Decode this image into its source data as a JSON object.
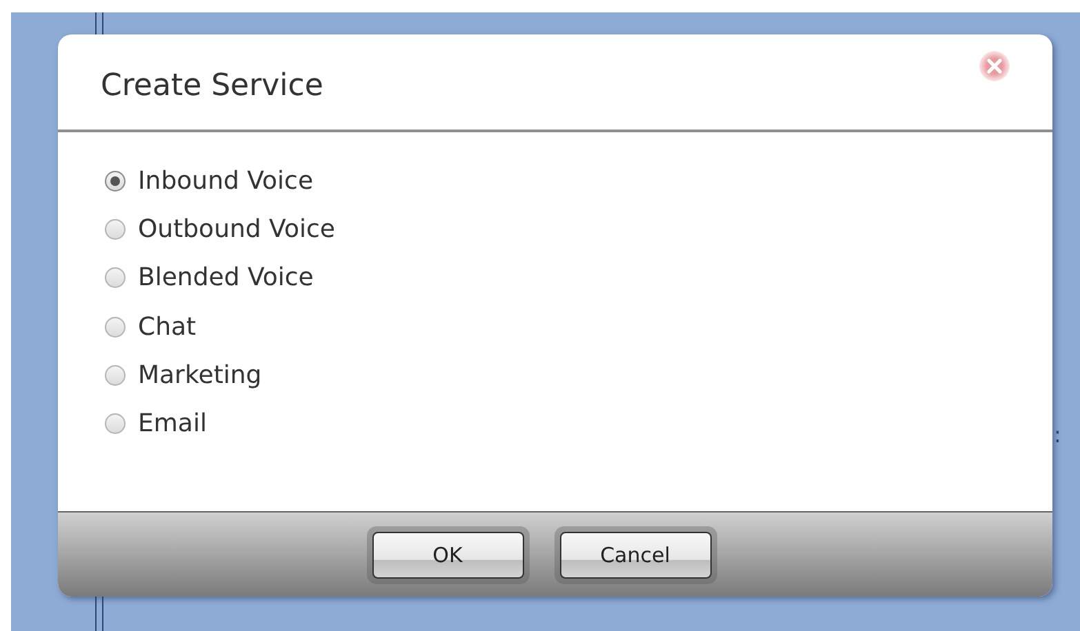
{
  "background": {
    "side_mark": ":"
  },
  "dialog": {
    "title": "Create Service",
    "options": [
      {
        "label": "Inbound Voice",
        "selected": true
      },
      {
        "label": "Outbound Voice",
        "selected": false
      },
      {
        "label": "Blended Voice",
        "selected": false
      },
      {
        "label": "Chat",
        "selected": false
      },
      {
        "label": "Marketing",
        "selected": false
      },
      {
        "label": "Email",
        "selected": false
      }
    ],
    "buttons": [
      "OK",
      "Cancel"
    ]
  }
}
